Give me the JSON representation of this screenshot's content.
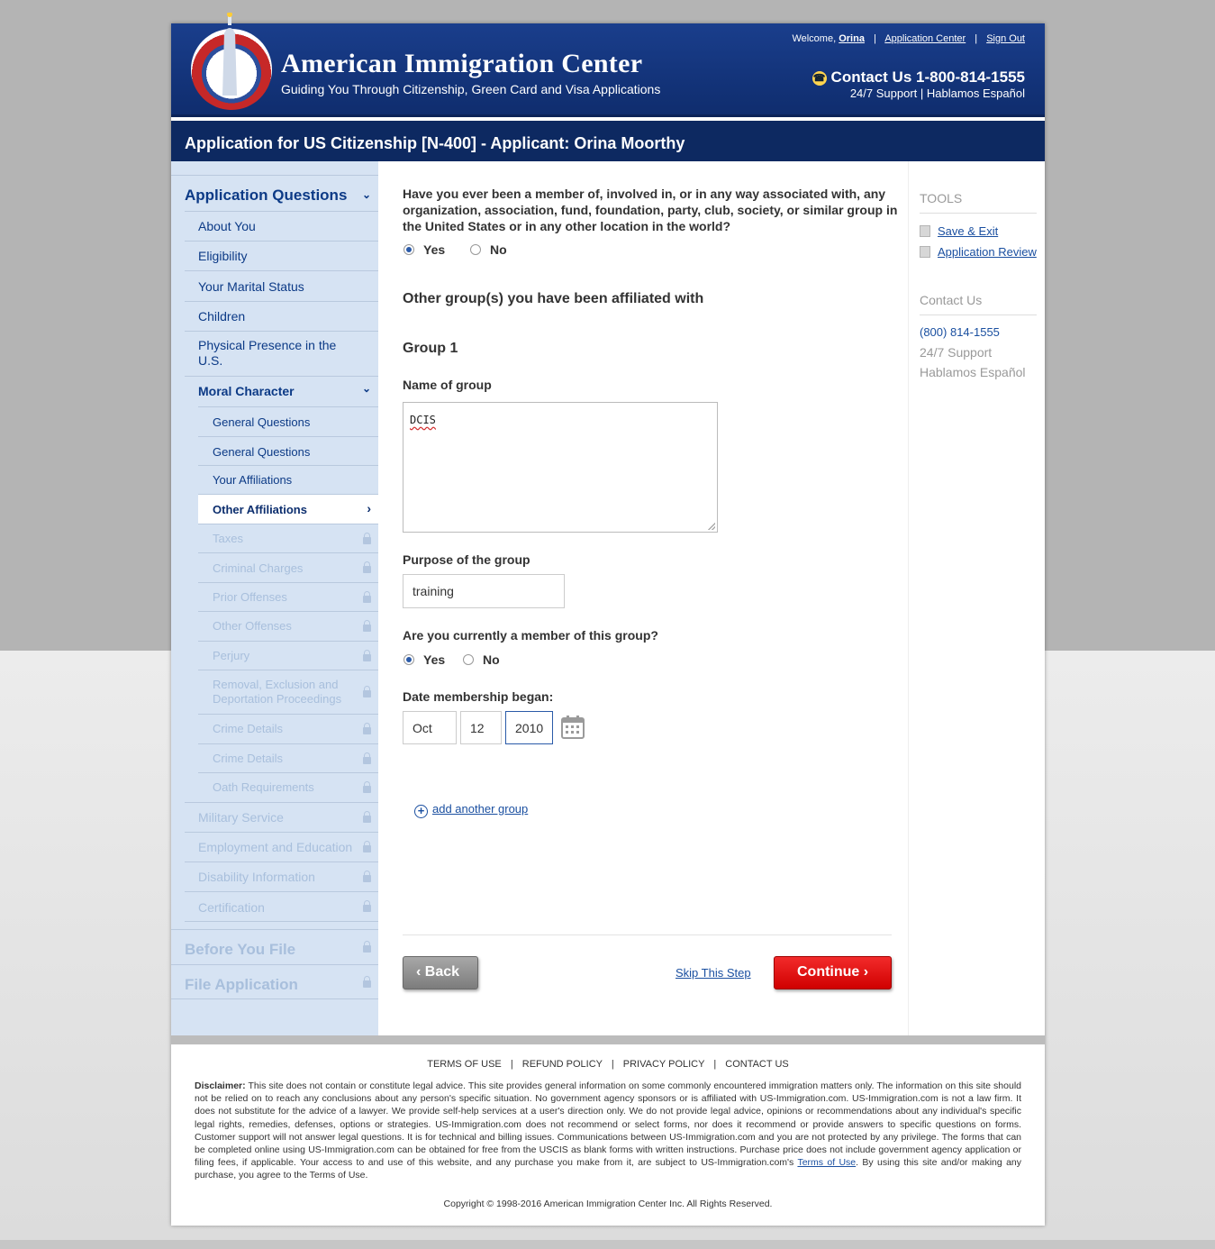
{
  "header": {
    "brand_name": "American Immigration Center",
    "tagline": "Guiding You Through Citizenship, Green Card and Visa Applications",
    "welcome_label": "Welcome,",
    "user_name": "Orina",
    "application_center": "Application Center",
    "sign_out": "Sign Out",
    "contact": "Contact Us 1-800-814-1555",
    "support": "24/7 Support | Hablamos Español"
  },
  "title_bar": "Application for US Citizenship [N-400] - Applicant: Orina Moorthy",
  "sidebar": {
    "section_questions": "Application Questions",
    "items": {
      "about_you": "About You",
      "eligibility": "Eligibility",
      "marital_status": "Your Marital Status",
      "children": "Children",
      "physical_presence": "Physical Presence in the U.S.",
      "moral_character": "Moral Character",
      "general_questions_1": "General Questions",
      "general_questions_2": "General Questions",
      "your_affiliations": "Your Affiliations",
      "other_affiliations": "Other Affiliations",
      "taxes": "Taxes",
      "criminal_charges": "Criminal Charges",
      "prior_offenses": "Prior Offenses",
      "other_offenses": "Other Offenses",
      "perjury": "Perjury",
      "removal": "Removal, Exclusion and Deportation Proceedings",
      "crime_details_1": "Crime Details",
      "crime_details_2": "Crime Details",
      "oath": "Oath Requirements",
      "military": "Military Service",
      "employment": "Employment and Education",
      "disability": "Disability Information",
      "certification": "Certification"
    },
    "before_you_file": "Before You File",
    "file_application": "File Application"
  },
  "main": {
    "question": "Have you ever been a member of, involved in, or in any way associated with, any organization, association, fund, foundation, party, club, society, or similar group in the United States or in any other location in the world?",
    "yes": "Yes",
    "no": "No",
    "q1_selected": "Yes",
    "section_title": "Other group(s) you have been affiliated with",
    "group_title": "Group 1",
    "name_label": "Name of group",
    "name_value": "DCIS",
    "purpose_label": "Purpose of the group",
    "purpose_value": "training",
    "member_label": "Are you currently a member of this group?",
    "member_selected": "Yes",
    "date_label": "Date membership began:",
    "date_month": "Oct",
    "date_day": "12",
    "date_year": "2010",
    "add_group": "add another group",
    "back": "Back",
    "skip": "Skip This Step",
    "continue": "Continue"
  },
  "rail": {
    "tools": "TOOLS",
    "save_exit": "Save & Exit",
    "app_review": "Application Review",
    "contact_head": "Contact Us",
    "phone": "(800) 814-1555",
    "support": "24/7 Support",
    "spanish": "Hablamos Español"
  },
  "footer": {
    "terms": "TERMS OF USE",
    "refund": "REFUND POLICY",
    "privacy": "PRIVACY POLICY",
    "contact": "CONTACT US",
    "disclaimer_label": "Disclaimer:",
    "disclaimer_text": "This site does not contain or constitute legal advice. This site provides general information on some commonly encountered immigration matters only. The information on this site should not be relied on to reach any conclusions about any person's specific situation. No government agency sponsors or is affiliated with US-Immigration.com. US-Immigration.com is not a law firm. It does not substitute for the advice of a lawyer. We provide self-help services at a user's direction only. We do not provide legal advice, opinions or recommendations about any individual's specific legal rights, remedies, defenses, options or strategies. US-Immigration.com does not recommend or select forms, nor does it recommend or provide answers to specific questions on forms. Customer support will not answer legal questions. It is for technical and billing issues. Communications between US-Immigration.com and you are not protected by any privilege. The forms that can be completed online using US-Immigration.com can be obtained for free from the USCIS as blank forms with written instructions. Purchase price does not include government agency application or filing fees, if applicable. Your access to and use of this website, and any purchase you make from it, are subject to US-Immigration.com's",
    "terms_link": "Terms of Use",
    "disclaimer_tail": ". By using this site and/or making any purchase, you agree to the Terms of Use.",
    "copyright": "Copyright © 1998-2016 American Immigration Center Inc. All Rights Reserved."
  },
  "colors": {
    "header_blue": "#1a3e8c",
    "title_bar": "#0d2961",
    "sidebar": "#d6e3f3",
    "continue_red": "#e01010",
    "link_blue": "#1a4fa0"
  }
}
